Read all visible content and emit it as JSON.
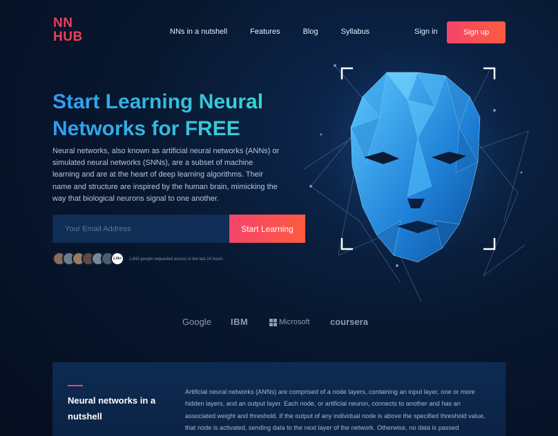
{
  "brand": {
    "line1": "NN",
    "line2": "HUB",
    "accent": "#f03e5a"
  },
  "nav": {
    "items": [
      "NNs in a nutshell",
      "Features",
      "Blog",
      "Syllabus"
    ],
    "signin": "Sign in",
    "signup": "Sign up"
  },
  "hero": {
    "title": "Start Learning Neural Networks for FREE",
    "description": "Neural networks, also known as artificial neural networks (ANNs) or simulated neural networks (SNNs), are a subset of machine learning and are at the heart of deep learning algorithms. Their name and structure are inspired by the human brain, mimicking the way that biological neurons signal to one another.",
    "email_placeholder": "Your Email Address",
    "cta": "Start Learning",
    "avatar_count": "1.6k+",
    "access_text": "1,643 people requested access in the last 24 hours",
    "illustration": "polygon-face-icon"
  },
  "partners": [
    "Google",
    "IBM",
    "Microsoft",
    "coursera"
  ],
  "section": {
    "title": "Neural networks in a nutshell",
    "body": "Artificial neural networks (ANNs) are comprised of a node layers, containing an input layer, one or more hidden layers, and an output layer. Each node, or artificial neuron, connects to another and has an associated weight and threshold. If the output of any individual node is above the specified threshold value, that node is activated, sending data to the next layer of the network. Otherwise, no data is passed"
  },
  "colors": {
    "gradient_start": "#f4456a",
    "gradient_end": "#ff5a40",
    "title_start": "#2f9bf2",
    "title_end": "#3cdcc9"
  }
}
